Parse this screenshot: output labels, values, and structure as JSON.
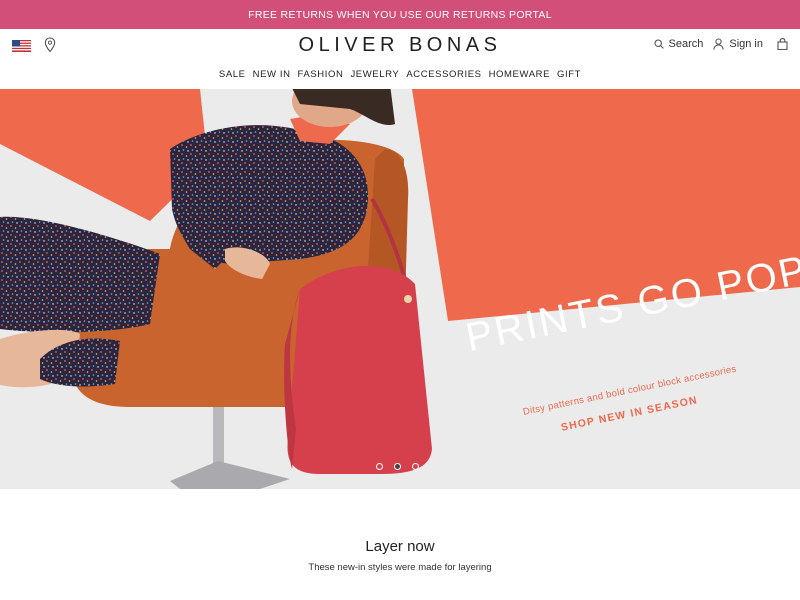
{
  "promo": {
    "text": "FREE RETURNS WHEN YOU USE OUR RETURNS PORTAL"
  },
  "header": {
    "brand": "OLIVER BONAS",
    "search_label": "Search",
    "signin_label": "Sign in",
    "country_icon": "us-flag-icon",
    "store_icon": "location-pin-icon",
    "cart_icon": "shopping-bag-icon"
  },
  "nav": {
    "items": [
      {
        "label": "SALE"
      },
      {
        "label": "NEW IN"
      },
      {
        "label": "FASHION"
      },
      {
        "label": "JEWELRY"
      },
      {
        "label": "ACCESSORIES"
      },
      {
        "label": "HOMEWARE"
      },
      {
        "label": "GIFT"
      }
    ]
  },
  "hero": {
    "headline": "PRINTS GO POP",
    "subtext": "Ditsy patterns and bold colour block accessories",
    "cta": "SHOP NEW IN SEASON",
    "slides": 3,
    "active_slide": 2,
    "colors": {
      "accent": "#ef6a4d",
      "background": "#ebebec",
      "bag": "#d6404d",
      "chair": "#c9642e"
    }
  },
  "section": {
    "title": "Layer now",
    "subtitle": "These new-in styles were made for layering"
  },
  "colors": {
    "promo_bar": "#d24f7a",
    "text": "#222222"
  }
}
